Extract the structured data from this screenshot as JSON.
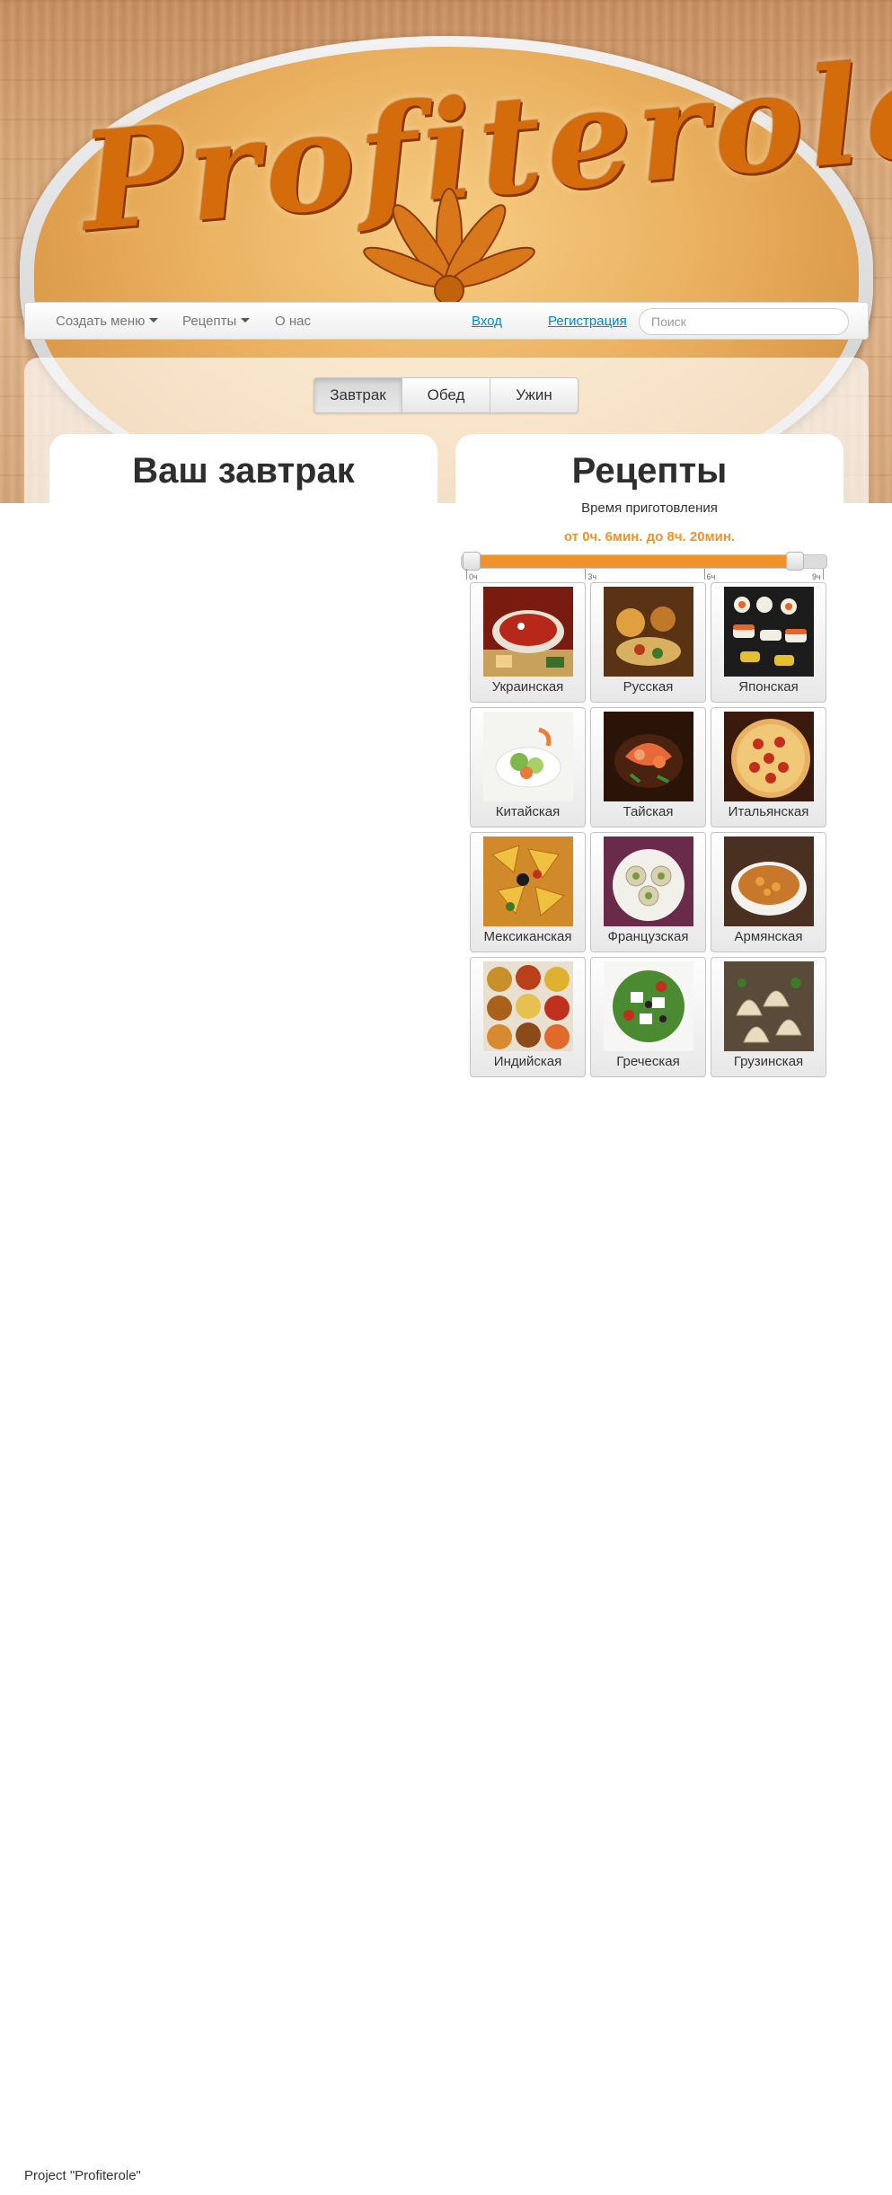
{
  "site": {
    "logo": "Profiterole"
  },
  "nav": {
    "create_menu": "Создать меню",
    "recipes": "Рецепты",
    "about": "О нас",
    "login": "Вход",
    "register": "Регистрация",
    "search_placeholder": "Поиск"
  },
  "meal_tabs": [
    {
      "label": "Завтрак",
      "active": true
    },
    {
      "label": "Обед",
      "active": false
    },
    {
      "label": "Ужин",
      "active": false
    }
  ],
  "left_panel": {
    "title": "Ваш завтрак"
  },
  "right_panel": {
    "title": "Рецепты",
    "cook_time_label": "Время приготовления",
    "cook_time_range": "от 0ч. 6мин. до 8ч. 20мин.",
    "slider": {
      "scale_max_hours": 9,
      "min_hours": 0.1,
      "max_hours": 8.333,
      "ticks": [
        "0ч",
        "3ч",
        "6ч",
        "9ч"
      ]
    }
  },
  "cuisines": [
    {
      "label": "Украинская",
      "icon": "borscht-photo"
    },
    {
      "label": "Русская",
      "icon": "russian-feast-photo"
    },
    {
      "label": "Японская",
      "icon": "sushi-photo"
    },
    {
      "label": "Китайская",
      "icon": "chinese-salad-photo"
    },
    {
      "label": "Тайская",
      "icon": "thai-seafood-photo"
    },
    {
      "label": "Итальянская",
      "icon": "pizza-photo"
    },
    {
      "label": "Мексиканская",
      "icon": "nachos-photo"
    },
    {
      "label": "Французская",
      "icon": "escargot-photo"
    },
    {
      "label": "Армянская",
      "icon": "armenian-soup-photo"
    },
    {
      "label": "Индийская",
      "icon": "spices-photo"
    },
    {
      "label": "Греческая",
      "icon": "greek-salad-photo"
    },
    {
      "label": "Грузинская",
      "icon": "khinkali-photo"
    }
  ],
  "footer": {
    "text": "Project \"Profiterole\""
  },
  "colors": {
    "accent": "#f0932b",
    "link": "#0088cc",
    "title": "#2e2e2e"
  }
}
